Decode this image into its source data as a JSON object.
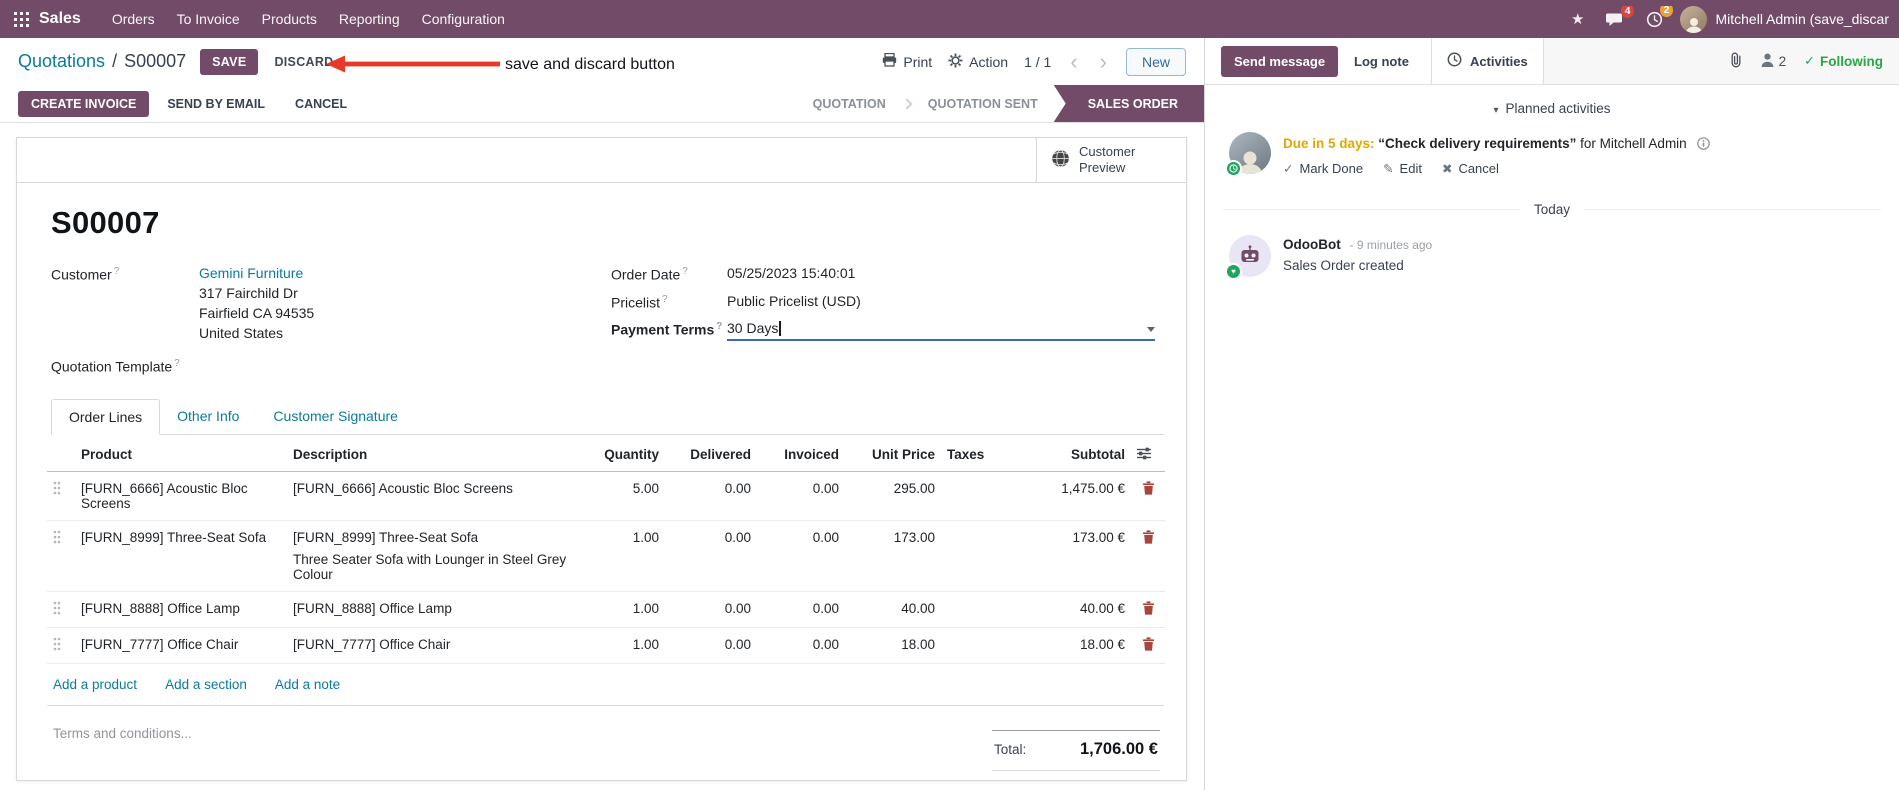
{
  "colors": {
    "brand_purple": "#714B67",
    "link_teal": "#0b7a9e",
    "due_orange": "#e0a800",
    "success_green": "#28a745",
    "annotation_red": "#e8382a",
    "focused_field_underline": "#3b66c4"
  },
  "topbar": {
    "app_name": "Sales",
    "menus": [
      {
        "label": "Orders"
      },
      {
        "label": "To Invoice"
      },
      {
        "label": "Products"
      },
      {
        "label": "Reporting"
      },
      {
        "label": "Configuration"
      }
    ],
    "messages_badge": "4",
    "activities_badge": "2",
    "user_name": "Mitchell Admin (save_discar"
  },
  "control_panel": {
    "breadcrumb_parent": "Quotations",
    "breadcrumb_separator": "/",
    "breadcrumb_current": "S00007",
    "save": "SAVE",
    "discard": "DISCARD",
    "print": "Print",
    "action": "Action",
    "pager": "1 / 1",
    "prev": "‹",
    "next": "›",
    "new": "New"
  },
  "annotation": {
    "label": "save and discard button"
  },
  "statusbar": {
    "create_invoice": "CREATE INVOICE",
    "send_by_email": "SEND BY EMAIL",
    "cancel": "CANCEL",
    "stages": [
      {
        "label": "QUOTATION",
        "active": false
      },
      {
        "label": "QUOTATION SENT",
        "active": false
      },
      {
        "label": "SALES ORDER",
        "active": true
      }
    ]
  },
  "form": {
    "customer_preview": "Customer Preview",
    "title": "S00007",
    "help_marker": "?",
    "fields": {
      "customer_label": "Customer",
      "customer_name": "Gemini Furniture",
      "customer_address_line1": "317 Fairchild Dr",
      "customer_address_line2": "Fairfield CA 94535",
      "customer_address_line3": "United States",
      "quotation_template_label": "Quotation Template",
      "order_date_label": "Order Date",
      "order_date_value": "05/25/2023 15:40:01",
      "pricelist_label": "Pricelist",
      "pricelist_value": "Public Pricelist (USD)",
      "payment_terms_label": "Payment Terms",
      "payment_terms_value": "30 Days"
    },
    "tabs": [
      {
        "label": "Order Lines",
        "active": true
      },
      {
        "label": "Other Info",
        "active": false
      },
      {
        "label": "Customer Signature",
        "active": false
      }
    ],
    "order_lines": {
      "columns": {
        "product": "Product",
        "description": "Description",
        "quantity": "Quantity",
        "delivered": "Delivered",
        "invoiced": "Invoiced",
        "unit_price": "Unit Price",
        "taxes": "Taxes",
        "subtotal": "Subtotal"
      },
      "rows": [
        {
          "product": "[FURN_6666] Acoustic Bloc Screens",
          "description": "[FURN_6666] Acoustic Bloc Screens",
          "description_line2": "",
          "quantity": "5.00",
          "delivered": "0.00",
          "invoiced": "0.00",
          "unit_price": "295.00",
          "taxes": "",
          "subtotal": "1,475.00 €",
          "edited": false
        },
        {
          "product": "[FURN_8999] Three-Seat Sofa",
          "description": "[FURN_8999] Three-Seat Sofa",
          "description_line2": "Three Seater Sofa with Lounger in Steel Grey Colour",
          "quantity": "1.00",
          "delivered": "0.00",
          "invoiced": "0.00",
          "unit_price": "173.00",
          "taxes": "",
          "subtotal": "173.00 €",
          "edited": true
        },
        {
          "product": "[FURN_8888] Office Lamp",
          "description": "[FURN_8888] Office Lamp",
          "description_line2": "",
          "quantity": "1.00",
          "delivered": "0.00",
          "invoiced": "0.00",
          "unit_price": "40.00",
          "taxes": "",
          "subtotal": "40.00 €",
          "edited": false
        },
        {
          "product": "[FURN_7777] Office Chair",
          "description": "[FURN_7777] Office Chair",
          "description_line2": "",
          "quantity": "1.00",
          "delivered": "0.00",
          "invoiced": "0.00",
          "unit_price": "18.00",
          "taxes": "",
          "subtotal": "18.00 €",
          "edited": false
        }
      ],
      "add_product": "Add a product",
      "add_section": "Add a section",
      "add_note": "Add a note"
    },
    "terms_placeholder": "Terms and conditions...",
    "total_label": "Total:",
    "total_value": "1,706.00 €"
  },
  "chatter": {
    "send_message": "Send message",
    "log_note": "Log note",
    "activities": "Activities",
    "followers_count": "2",
    "following": "Following",
    "planned_header": "Planned activities",
    "activity": {
      "due": "Due in 5 days:",
      "summary": "“Check delivery requirements”",
      "assigned": "for Mitchell Admin",
      "mark_done": "Mark Done",
      "edit": "Edit",
      "cancel": "Cancel"
    },
    "today": "Today",
    "message": {
      "author": "OdooBot",
      "time": "- 9 minutes ago",
      "body": "Sales Order created"
    }
  }
}
